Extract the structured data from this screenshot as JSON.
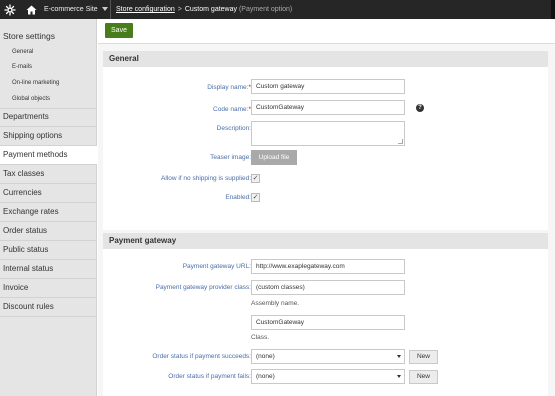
{
  "header": {
    "site_selector": "E-commerce Site",
    "breadcrumb_link": "Store configuration",
    "breadcrumb_separator": ">",
    "breadcrumb_current": "Custom gateway",
    "breadcrumb_sub": "(Payment option)"
  },
  "sidebar": {
    "group_title": "Store settings",
    "sub_items": [
      "General",
      "E-mails",
      "On-line marketing",
      "Global objects"
    ],
    "items": [
      "Departments",
      "Shipping options",
      "Payment methods",
      "Tax classes",
      "Currencies",
      "Exchange rates",
      "Order status",
      "Public status",
      "Internal status",
      "Invoice",
      "Discount rules"
    ],
    "active_item": "Payment methods"
  },
  "toolbar": {
    "save_label": "Save"
  },
  "general": {
    "title": "General",
    "display_name_label": "Display name:",
    "display_name_value": "Custom gateway",
    "code_name_label": "Code name:",
    "code_name_value": "CustomGateway",
    "required_mark": "*",
    "help_glyph": "?",
    "description_label": "Description:",
    "description_value": "",
    "teaser_label": "Teaser image:",
    "upload_label": "Upload file",
    "allow_shipping_label": "Allow if no shipping is supplied:",
    "enabled_label": "Enabled:",
    "check_glyph": "✓"
  },
  "gateway": {
    "title": "Payment gateway",
    "url_label": "Payment gateway URL:",
    "url_value": "http://www.exaplegateway.com",
    "provider_label": "Payment gateway provider class:",
    "assembly_value": "(custom classes)",
    "assembly_hint": "Assembly name.",
    "class_value": "CustomGateway",
    "class_hint": "Class.",
    "succeeds_label": "Order status if payment succeeds:",
    "succeeds_value": "(none)",
    "fails_label": "Order status if payment fails:",
    "fails_value": "(none)",
    "new_label": "New"
  },
  "colors": {
    "accent": "#497d1b",
    "label": "#4a6ea8",
    "topbar": "#262626",
    "required": "#c00000"
  }
}
